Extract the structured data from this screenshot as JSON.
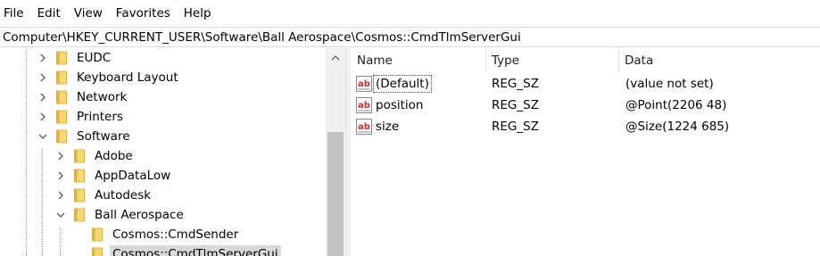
{
  "menu": [
    "File",
    "Edit",
    "View",
    "Favorites",
    "Help"
  ],
  "address": "Computer\\HKEY_CURRENT_USER\\Software\\Ball Aerospace\\Cosmos::CmdTlmServerGui",
  "tree": [
    {
      "label": "EUDC",
      "chevron": "right"
    },
    {
      "label": "Keyboard Layout",
      "chevron": "right"
    },
    {
      "label": "Network",
      "chevron": "right"
    },
    {
      "label": "Printers",
      "chevron": "right"
    },
    {
      "label": "Software",
      "chevron": "down"
    },
    {
      "label": "Adobe",
      "chevron": "right"
    },
    {
      "label": "AppDataLow",
      "chevron": "right"
    },
    {
      "label": "Autodesk",
      "chevron": "right"
    },
    {
      "label": "Ball Aerospace",
      "chevron": "down"
    },
    {
      "label": "Cosmos::CmdSender",
      "chevron": "none"
    },
    {
      "label": "Cosmos::CmdTlmServerGui",
      "chevron": "none",
      "selected": true
    }
  ],
  "columns": [
    "Name",
    "Type",
    "Data"
  ],
  "values": [
    {
      "name": "(Default)",
      "type": "REG_SZ",
      "data": "(value not set)",
      "icon": "string-value-icon"
    },
    {
      "name": "position",
      "type": "REG_SZ",
      "data": "@Point(2206 48)",
      "icon": "string-value-icon"
    },
    {
      "name": "size",
      "type": "REG_SZ",
      "data": "@Size(1224 685)",
      "icon": "string-value-icon"
    }
  ],
  "colors": {
    "folder": "#f8d775",
    "folder_dark": "#e0b03c",
    "selection": "#d9d9d9",
    "ab_red": "#c62d2d"
  }
}
